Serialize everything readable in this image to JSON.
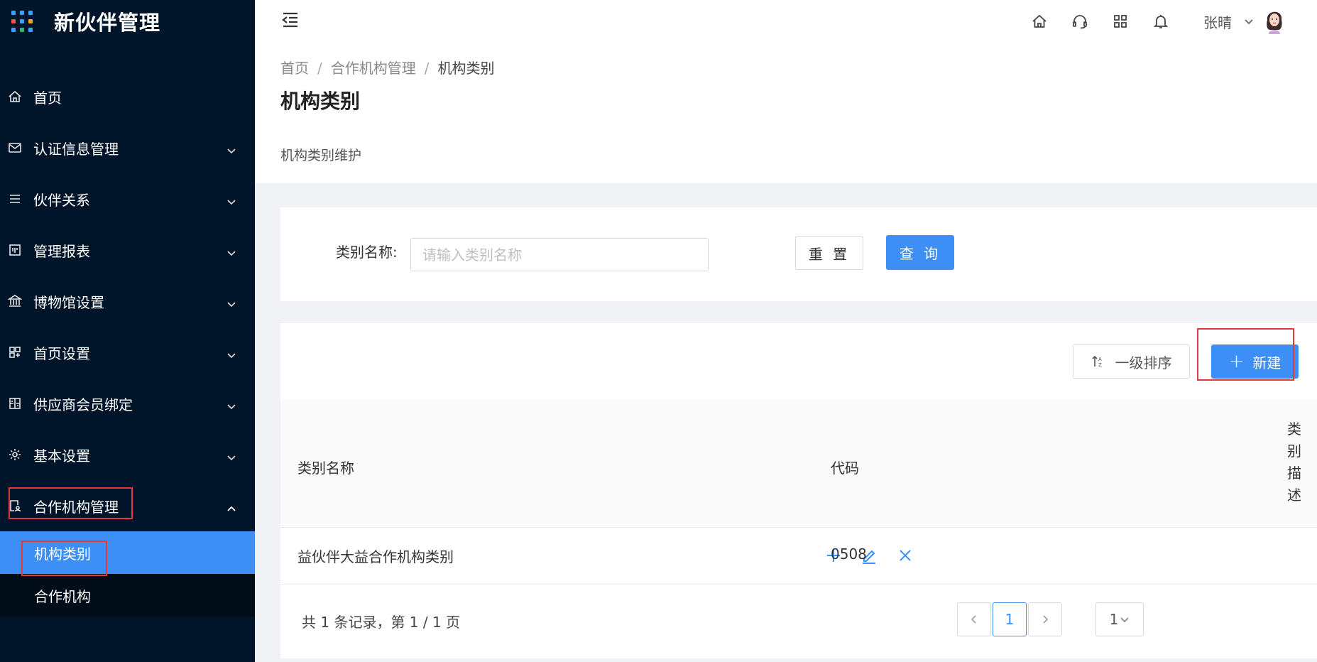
{
  "app": {
    "title": "新伙伴管理"
  },
  "sidebar": {
    "items": [
      {
        "label": "首页",
        "icon": "home-icon",
        "expandable": false
      },
      {
        "label": "认证信息管理",
        "icon": "mail-icon",
        "expandable": true
      },
      {
        "label": "伙伴关系",
        "icon": "list-icon",
        "expandable": true
      },
      {
        "label": "管理报表",
        "icon": "board-icon",
        "expandable": true
      },
      {
        "label": "博物馆设置",
        "icon": "bank-icon",
        "expandable": true
      },
      {
        "label": "首页设置",
        "icon": "layout-icon",
        "expandable": true
      },
      {
        "label": "供应商会员绑定",
        "icon": "link-icon",
        "expandable": true
      },
      {
        "label": "基本设置",
        "icon": "gear-icon",
        "expandable": true
      },
      {
        "label": "合作机构管理",
        "icon": "doc-user-icon",
        "expandable": true,
        "expanded": true
      }
    ],
    "submenu": [
      {
        "label": "机构类别",
        "active": true
      },
      {
        "label": "合作机构",
        "active": false
      }
    ]
  },
  "header": {
    "user_name": "张晴",
    "icons": [
      "home-icon",
      "headset-icon",
      "apps-icon",
      "bell-icon"
    ]
  },
  "breadcrumb": {
    "items": [
      "首页",
      "合作机构管理",
      "机构类别"
    ]
  },
  "page": {
    "title": "机构类别",
    "description": "机构类别维护"
  },
  "search": {
    "label": "类别名称:",
    "placeholder": "请输入类别名称",
    "value": "",
    "reset_label": "重 置",
    "query_label": "查 询"
  },
  "toolbar": {
    "sort_label": "一级排序",
    "new_label": "新建"
  },
  "table": {
    "columns": [
      "类别名称",
      "代码",
      "类别描述"
    ],
    "rows": [
      {
        "name": "益伙伴大益合作机构类别",
        "code": "0508",
        "description": ""
      }
    ]
  },
  "pagination": {
    "summary": "共 1 条记录，第 1 / 1 页",
    "current_page": "1",
    "page_size": "1"
  },
  "colors": {
    "sidebar_bg": "#001529",
    "accent": "#3d8ff5",
    "highlight_border": "#e53935"
  }
}
